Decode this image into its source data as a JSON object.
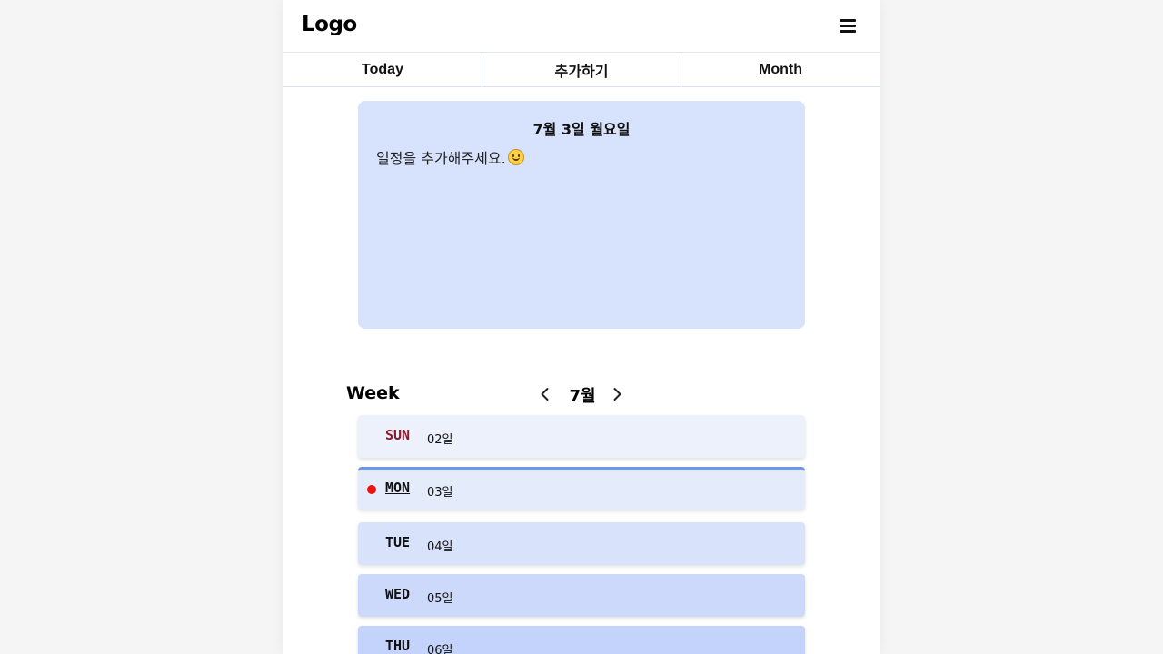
{
  "header": {
    "logo": "Logo",
    "menu_icon": "hamburger-menu-icon"
  },
  "tabs": [
    {
      "label": "Today"
    },
    {
      "label": "추가하기"
    },
    {
      "label": "Month"
    }
  ],
  "day_card": {
    "title": "7월 3일 월요일",
    "empty_message": "일정을 추가해주세요.",
    "emoji_icon": "smiling-face-icon"
  },
  "week": {
    "label": "Week",
    "month": "7월",
    "prev_icon": "chevron-left-icon",
    "next_icon": "chevron-right-icon",
    "days": [
      {
        "weekday": "SUN",
        "date": "02일",
        "bg": "#edf1fb",
        "current": false
      },
      {
        "weekday": "MON",
        "date": "03일",
        "bg": "#e4ebfb",
        "current": true
      },
      {
        "weekday": "TUE",
        "date": "04일",
        "bg": "#d8e3fb",
        "current": false
      },
      {
        "weekday": "WED",
        "date": "05일",
        "bg": "#cdd9fb",
        "current": false
      },
      {
        "weekday": "THU",
        "date": "06일",
        "bg": "#c3d3fc",
        "current": false
      }
    ]
  },
  "colors": {
    "card_bg": "#d7e3fc",
    "today_dot": "#ee0f0f",
    "current_day_border": "#6a98ea",
    "sunday_text": "#8b1a2a"
  }
}
